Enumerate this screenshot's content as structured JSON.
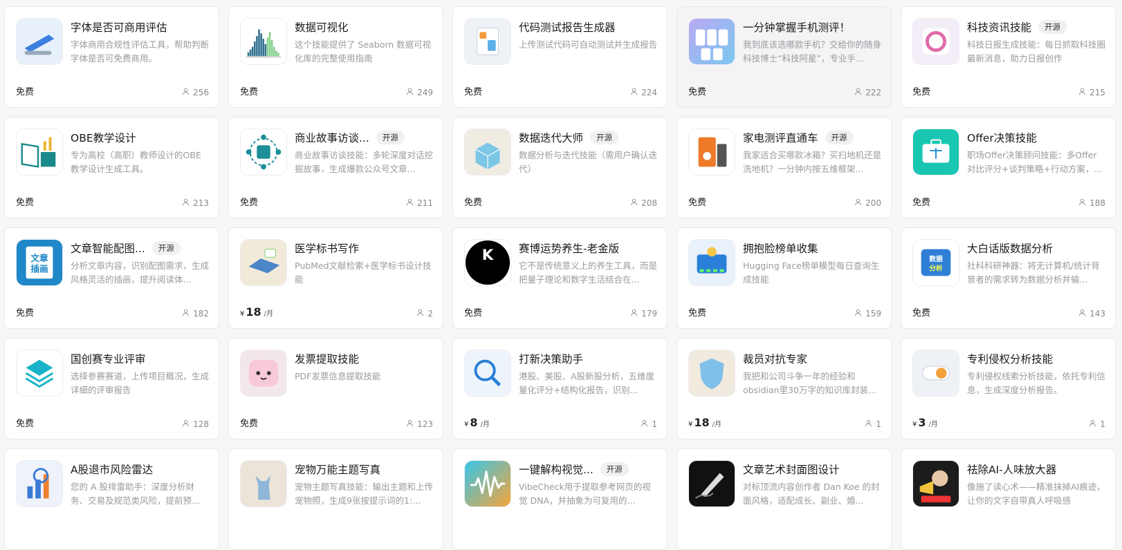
{
  "cards": [
    {
      "title": "字体是否可商用评估",
      "badge": "",
      "desc": "字体商用合规性评估工具，帮助判断字体是否可免费商用。",
      "price": "免费",
      "cur": "",
      "amount": "",
      "period": "",
      "users": "256",
      "icon": "stapler-icon",
      "colors": [
        "#e8f1fb",
        "#3b7fe0"
      ]
    },
    {
      "title": "数据可视化",
      "badge": "",
      "desc": "这个技能提供了 Seaborn 数据可视化库的完整使用指南",
      "price": "",
      "cur": "",
      "amount": "",
      "period": "",
      "free": "免费",
      "users": "249",
      "icon": "chart-icon",
      "colors": [
        "#ffffff",
        "#2e6f8f"
      ]
    },
    {
      "title": "代码测试报告生成器",
      "badge": "",
      "desc": "上传测试代码可自动测试并生成报告",
      "price": "免费",
      "users": "224",
      "icon": "report-icon",
      "colors": [
        "#eef2f6",
        "#f29a3a"
      ]
    },
    {
      "title": "一分钟掌握手机测评！",
      "badge": "",
      "desc": "我到底该选哪款手机？交给你的随身科技博士“科技阿星”，专业手…",
      "price": "免费",
      "users": "222",
      "icon": "phones-icon",
      "colors": [
        "#b9a8f2",
        "#7ac8f0"
      ],
      "highlight": true
    },
    {
      "title": "科技资讯技能",
      "badge": "开源",
      "desc": "科技日报生成技能：每日抓取科技圈最新消息，助力日报创作",
      "price": "免费",
      "users": "215",
      "icon": "dial-icon",
      "colors": [
        "#f3edf7",
        "#e06aa8"
      ]
    },
    {
      "title": "OBE教学设计",
      "badge": "",
      "desc": "专为高校（高职）教师设计的OBE教学设计生成工具。",
      "price": "免费",
      "users": "213",
      "icon": "book-chart-icon",
      "colors": [
        "#ffffff",
        "#1b8a8a"
      ]
    },
    {
      "title": "商业故事访谈...",
      "badge": "开源",
      "desc": "商业故事访谈技能：多轮深度对话挖掘故事，生成爆款公众号文章...",
      "price": "免费",
      "users": "211",
      "icon": "money-cycle-icon",
      "colors": [
        "#ffffff",
        "#1c8f9a"
      ]
    },
    {
      "title": "数据迭代大师",
      "badge": "开源",
      "desc": "数据分析与迭代技能（需用户确认迭代）",
      "price": "免费",
      "users": "208",
      "icon": "cube-icon",
      "colors": [
        "#f1ece2",
        "#7cc6e6"
      ]
    },
    {
      "title": "家电测评直通车",
      "badge": "开源",
      "desc": "我家适合买哪款冰箱？买扫地机还是洗地机？一分钟内按五维框架...",
      "price": "免费",
      "users": "200",
      "icon": "appliance-icon",
      "colors": [
        "#ffffff",
        "#ef7a2a"
      ]
    },
    {
      "title": "Offer决策技能",
      "badge": "",
      "desc": "职场Offer决策顾问技能：多Offer对比评分+谈判策略+行动方案，...",
      "price": "免费",
      "users": "188",
      "icon": "briefcase-icon",
      "colors": [
        "#18c6b2",
        "#1a8fd8"
      ]
    },
    {
      "title": "文章智能配图...",
      "badge": "开源",
      "desc": "分析文章内容，识别配图需求，生成风格灵活的插画，提升阅读体...",
      "price": "免费",
      "users": "182",
      "icon": "article-icon",
      "colors": [
        "#1e88c8",
        "#ffffff"
      ]
    },
    {
      "title": "医学标书写作",
      "badge": "",
      "desc": "PubMed文献检索+医学标书设计技能",
      "price": "",
      "cur": "¥",
      "amount": "18",
      "period": "/月",
      "users": "2",
      "icon": "medical-book-icon",
      "colors": [
        "#f2ead9",
        "#4a86c8"
      ]
    },
    {
      "title": "赛博运势养生-老金版",
      "badge": "",
      "desc": "它不是传统意义上的养生工具，而是把量子理论和数字生活结合在...",
      "price": "免费",
      "users": "179",
      "icon": "k-logo-icon",
      "colors": [
        "#000000",
        "#ffffff"
      ]
    },
    {
      "title": "拥抱脸榜单收集",
      "badge": "",
      "desc": "Hugging Face榜单模型每日查询生成技能",
      "price": "免费",
      "users": "159",
      "icon": "leaderboard-icon",
      "colors": [
        "#e9f1fb",
        "#2a7fd8"
      ]
    },
    {
      "title": "大白话版数据分析",
      "badge": "",
      "desc": "社科科研神器：将无计算机/统计背景者的需求转为数据分析并输...",
      "price": "免费",
      "users": "143",
      "icon": "plain-data-icon",
      "colors": [
        "#ffffff",
        "#2f7fd6"
      ]
    },
    {
      "title": "国创赛专业评审",
      "badge": "",
      "desc": "选择参赛赛道，上传项目概况，生成详细的评审报告",
      "price": "免费",
      "users": "128",
      "icon": "layers-icon",
      "colors": [
        "#ffffff",
        "#19b3c9"
      ]
    },
    {
      "title": "发票提取技能",
      "badge": "",
      "desc": "PDF发票信息提取技能",
      "price": "免费",
      "users": "123",
      "icon": "cute-face-icon",
      "colors": [
        "#f3e7ee",
        "#f8c9d8"
      ]
    },
    {
      "title": "打新决策助手",
      "badge": "",
      "desc": "港股、美股、A股新股分析，五维度量化评分+结构化报告，识别...",
      "price": "",
      "cur": "¥",
      "amount": "8",
      "period": "/月",
      "users": "1",
      "icon": "magnifier-icon",
      "colors": [
        "#eef4fb",
        "#2a7fd8"
      ]
    },
    {
      "title": "裁员对抗专家",
      "badge": "",
      "desc": "我把和公司斗争一年的经验和obsidian里30万字的知识库封装...",
      "price": "",
      "cur": "¥",
      "amount": "18",
      "period": "/月",
      "users": "1",
      "icon": "shield-icon",
      "colors": [
        "#f1eade",
        "#7fc0ea"
      ]
    },
    {
      "title": "专利侵权分析技能",
      "badge": "",
      "desc": "专利侵权线索分析技能，依托专利信息，生成深度分析报告。",
      "price": "",
      "cur": "¥",
      "amount": "3",
      "period": "/月",
      "users": "1",
      "icon": "toggle-icon",
      "colors": [
        "#eef1f5",
        "#f2a23a"
      ]
    },
    {
      "title": "A股退市风险雷达",
      "badge": "",
      "desc": "您的 A 股排雷助手：深度分析财务、交易及规范类风险，提前预...",
      "price": "",
      "users": "",
      "icon": "bars-icon",
      "colors": [
        "#eef3fb",
        "#3a7bd5"
      ]
    },
    {
      "title": "宠物万能主题写真",
      "badge": "",
      "desc": "宠物主题写真技能：输出主题和上传宠物照，生成9张按提示词的1:...",
      "price": "",
      "users": "",
      "icon": "cat-icon",
      "colors": [
        "#ece4d8",
        "#8fb6d8"
      ]
    },
    {
      "title": "一键解构视觉...",
      "badge": "开源",
      "desc": "VibeCheck用于提取参考网页的视觉 DNA，并抽象为可复用的...",
      "price": "",
      "users": "",
      "icon": "waveform-icon",
      "colors": [
        "#38c6e8",
        "#f6a43a"
      ]
    },
    {
      "title": "文章艺术封面图设计",
      "badge": "",
      "desc": "对标顶流内容创作者 Dan Koe 的封面风格，适配成长、副业、婚...",
      "price": "",
      "users": "",
      "icon": "pen-ink-icon",
      "colors": [
        "#111111",
        "#dddddd"
      ]
    },
    {
      "title": "祛除AI-人味放大器",
      "badge": "",
      "desc": "像施了读心术——精准抹掉AI痕迹，让你的文字自带真人呼吸感",
      "price": "",
      "users": "",
      "icon": "megaphone-icon",
      "colors": [
        "#1c1c1c",
        "#f2c23a"
      ]
    }
  ],
  "free_label": "免费"
}
